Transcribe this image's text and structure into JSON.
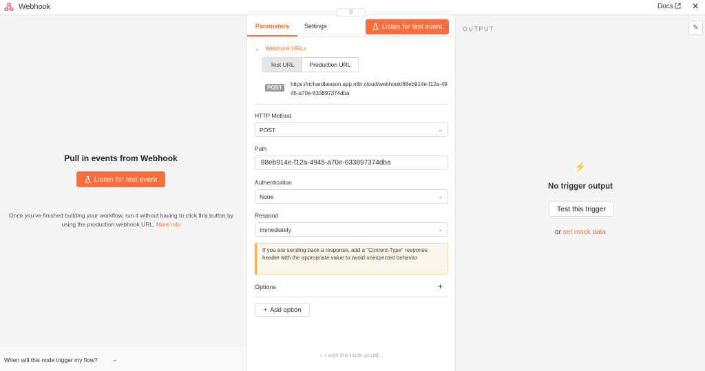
{
  "header": {
    "title": "Webhook",
    "docs_label": "Docs",
    "close_glyph": "✕",
    "logo_icon": "webhook-icon",
    "external_icon": "external-link-icon"
  },
  "input_panel": {
    "heading": "Pull in events from Webhook",
    "listen_button": "Listen for test event",
    "description": "Once you’ve finished building your workflow, run it without having to click this button by using the production webhook URL.",
    "more_info": "More info",
    "footer_question": "When will this node trigger my flow?"
  },
  "parameters_panel": {
    "drag_handle_glyph": "|||",
    "tabs": [
      {
        "label": "Parameters",
        "active": true
      },
      {
        "label": "Settings",
        "active": false
      }
    ],
    "listen_button": "Listen for test event",
    "webhook_urls": {
      "label": "Webhook URLs",
      "toggle_options": [
        "Test URL",
        "Production URL"
      ],
      "selected": "Test URL",
      "method": "POST",
      "url": "https://richardlawson.app.n8n.cloud/webhook/88eb914e-f12a-4945-a70e-633897374dba"
    },
    "http_method": {
      "label": "HTTP Method",
      "value": "POST"
    },
    "path": {
      "label": "Path",
      "value": "88eb914e-f12a-4945-a70e-633897374dba"
    },
    "authentication": {
      "label": "Authentication",
      "value": "None"
    },
    "respond": {
      "label": "Respond",
      "value": "Immediately"
    },
    "notice": "If you are sending back a response, add a \"Content-Type\" response header with the appropriate value to avoid unexpected behavior",
    "options_label": "Options",
    "add_option_button": "Add option",
    "wish_link": "I wish this node would..."
  },
  "output_panel": {
    "label": "OUTPUT",
    "empty_title": "No trigger output",
    "test_button": "Test this trigger",
    "or_text": "or",
    "mock_link": "set mock data"
  },
  "colors": {
    "accent": "#ff6d3a",
    "panel_bg": "#f5f5f5",
    "notice_border": "#f6b24d"
  }
}
